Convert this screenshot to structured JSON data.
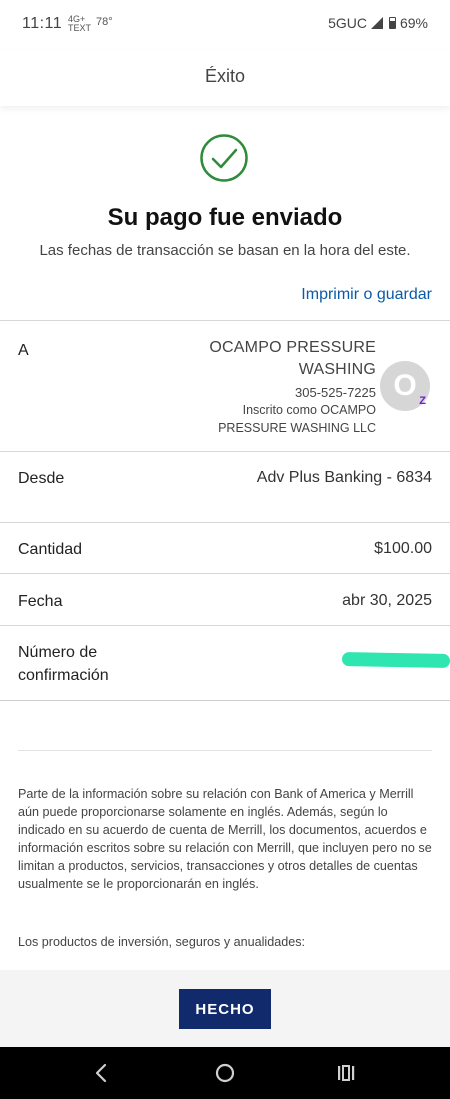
{
  "status_bar": {
    "time": "11:11",
    "notif_line1": "4G+",
    "notif_line2": "TEXT",
    "temperature": "78°",
    "network": "5GUC",
    "battery": "69%"
  },
  "header": {
    "title": "Éxito"
  },
  "success": {
    "title": "Su pago fue enviado",
    "subtitle": "Las fechas de transacción se basan en la hora del este.",
    "print_link": "Imprimir o guardar"
  },
  "details": {
    "to": {
      "label": "A",
      "name_line1": "OCAMPO PRESSURE",
      "name_line2": "WASHING",
      "phone": "305-525-7225",
      "enrolled_line1": "Inscrito como OCAMPO",
      "enrolled_line2": "PRESSURE WASHING LLC",
      "avatar_initial": "O",
      "badge": "Z"
    },
    "from": {
      "label": "Desde",
      "value": "Adv Plus Banking - 6834"
    },
    "amount": {
      "label": "Cantidad",
      "value": "$100.00"
    },
    "date": {
      "label": "Fecha",
      "value": "abr 30, 2025"
    },
    "confirmation": {
      "label_line1": "Número de",
      "label_line2": "confirmación"
    }
  },
  "disclaimer": {
    "paragraph1": "Parte de la información sobre su relación con Bank of America y Merrill aún puede proporcionarse solamente en inglés. Además, según lo indicado en su acuerdo de cuenta de Merrill, los documentos, acuerdos e información escritos sobre su relación con Merrill, que incluyen pero no se limitan a productos, servicios, transacciones y otros detalles de cuentas usualmente se le proporcionarán en inglés.",
    "paragraph2": "Los productos de inversión, seguros y anualidades:"
  },
  "footer": {
    "done_label": "HECHO"
  },
  "colors": {
    "success_green": "#2e8b3a",
    "link_blue": "#0a5aa8",
    "button_navy": "#112a6b",
    "redaction_green": "#2fe6b0"
  },
  "icons": {
    "success": "check-circle-icon",
    "back": "back-icon",
    "home": "home-icon",
    "recents": "recents-icon"
  }
}
